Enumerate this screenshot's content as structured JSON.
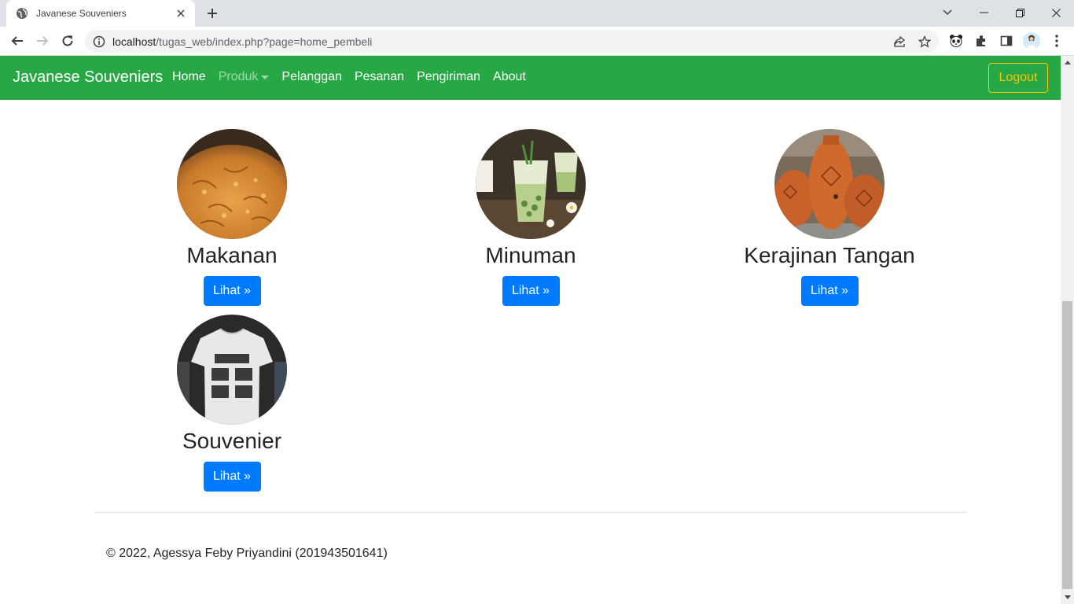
{
  "browser": {
    "tab_title": "Javanese Souveniers",
    "url_host": "localhost",
    "url_path": "/tugas_web/index.php?page=home_pembeli"
  },
  "navbar": {
    "brand": "Javanese Souveniers",
    "links": [
      "Home",
      "Produk",
      "Pelanggan",
      "Pesanan",
      "Pengiriman",
      "About"
    ],
    "logout": "Logout",
    "colors": {
      "bg": "#28a745",
      "logout": "#ffc107"
    }
  },
  "categories": [
    {
      "title": "Makanan",
      "button": "Lihat »"
    },
    {
      "title": "Minuman",
      "button": "Lihat »"
    },
    {
      "title": "Kerajinan Tangan",
      "button": "Lihat »"
    },
    {
      "title": "Souvenier",
      "button": "Lihat »"
    }
  ],
  "footer": {
    "copyright": "© 2022, Agessya Feby Priyandini (201943501641)"
  },
  "colors": {
    "primary": "#007bff"
  }
}
